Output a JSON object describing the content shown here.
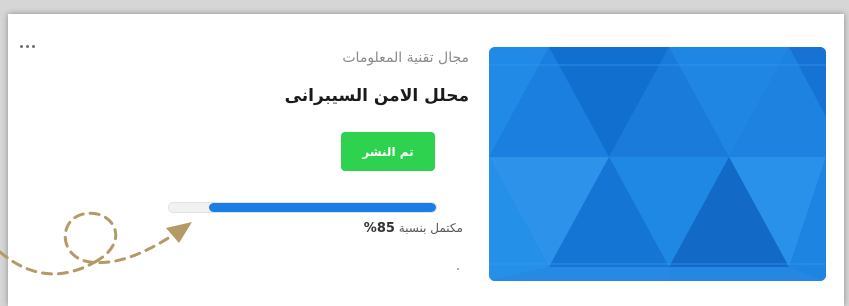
{
  "card": {
    "category": "مجال تقنية المعلومات",
    "title": "محلل الامن السيبرانى",
    "publish_label": "تم النشر",
    "progress": {
      "prefix": "مكتمل بنسبة",
      "value_label": "85%",
      "percent": 85
    },
    "more_icon": "more-horizontal-icon",
    "thumbnail": "blue-triangle-pattern"
  },
  "annotation": {
    "icon": "dashed-curved-arrow",
    "color": "#b49a66"
  },
  "colors": {
    "accent_blue": "#1a7ee6",
    "publish_green": "#2fd24f"
  }
}
